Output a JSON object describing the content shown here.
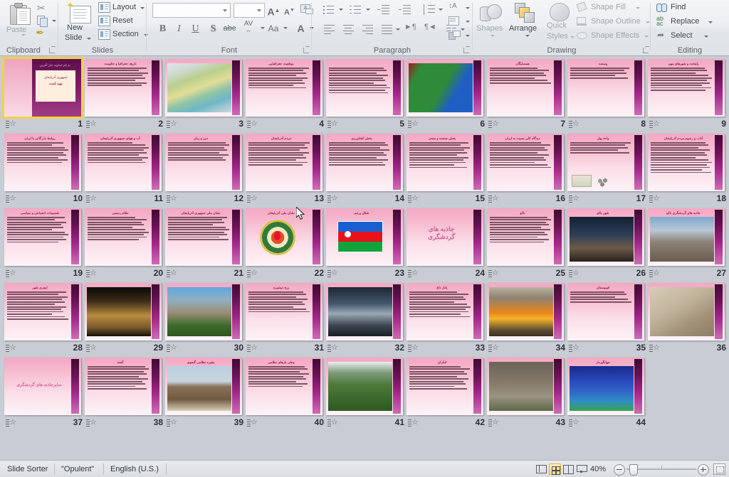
{
  "app": {
    "view_name": "Slide Sorter",
    "theme_name": "\"Opulent\"",
    "language": "English (U.S.)",
    "zoom_level": "40%"
  },
  "ribbon": {
    "groups": [
      {
        "name": "Clipboard",
        "label": "Clipboard"
      },
      {
        "name": "Slides",
        "label": "Slides"
      },
      {
        "name": "Font",
        "label": "Font"
      },
      {
        "name": "Paragraph",
        "label": "Paragraph"
      },
      {
        "name": "Drawing",
        "label": "Drawing"
      },
      {
        "name": "Editing",
        "label": "Editing"
      }
    ],
    "clipboard": {
      "paste_label": "Paste",
      "cut_icon": "scissors-icon",
      "copy_icon": "copy-icon",
      "format_painter_icon": "format-painter-icon"
    },
    "slides": {
      "new_slide_label": "New\nSlide",
      "new_slide_line1": "New",
      "new_slide_line2": "Slide",
      "layout_label": "Layout",
      "reset_label": "Reset",
      "section_label": "Section"
    },
    "font": {
      "font_name_value": "",
      "font_size_value": "",
      "grow_font": "A",
      "shrink_font": "A",
      "clear_formatting": "clear-formatting-icon",
      "bold": "B",
      "italic": "I",
      "underline": "U",
      "shadow": "S",
      "strikethrough": "abc",
      "character_spacing": "AV",
      "change_case": "Aa",
      "font_color": "A"
    },
    "paragraph": {
      "bullets": "bullets-icon",
      "numbering": "numbering-icon",
      "decrease_indent": "decrease-indent-icon",
      "increase_indent": "increase-indent-icon",
      "line_spacing": "line-spacing-icon",
      "align_left": "align-left-icon",
      "center": "center-icon",
      "align_right": "align-right-icon",
      "justify": "justify-icon",
      "ltr": "text-direction-ltr-icon",
      "rtl": "text-direction-rtl-icon",
      "columns": "columns-icon",
      "text_direction": "text-direction-icon",
      "align_text": "align-text-icon",
      "convert_smartart": "convert-to-smartart-icon"
    },
    "drawing": {
      "shapes_label": "Shapes",
      "arrange_label": "Arrange",
      "quick_styles_line1": "Quick",
      "quick_styles_line2": "Styles",
      "shape_fill_label": "Shape Fill",
      "shape_outline_label": "Shape Outline",
      "shape_effects_label": "Shape Effects"
    },
    "editing": {
      "find_label": "Find",
      "replace_label": "Replace",
      "select_label": "Select"
    }
  },
  "status_bar": {
    "view_buttons": [
      {
        "name": "normal-view-button",
        "active": false
      },
      {
        "name": "slide-sorter-view-button",
        "active": true
      },
      {
        "name": "reading-view-button",
        "active": false
      },
      {
        "name": "slide-show-button",
        "active": false
      }
    ],
    "fit_to_window_title": "Fit slide to current window"
  },
  "sorter": {
    "selected_slide": 1,
    "columns": 9,
    "slides": [
      {
        "n": 1,
        "kind": "title",
        "title": "جمهوری آذربایجان",
        "kicker": "به نام خداوند جان آفرین",
        "sub": "جمهوری آذربایجان",
        "sub2": "تهیه کننده",
        "lines": 0
      },
      {
        "n": 2,
        "kind": "text",
        "title": "تاریخ، جغرافیا و حکومت",
        "lines": 8
      },
      {
        "n": 3,
        "kind": "pic",
        "title": "",
        "pic": "relief-map"
      },
      {
        "n": 4,
        "kind": "text",
        "title": "موقعیت جغرافیایی",
        "lines": 9
      },
      {
        "n": 5,
        "kind": "text",
        "title": "",
        "lines": 11
      },
      {
        "n": 6,
        "kind": "pic",
        "title": "",
        "pic": "political-map"
      },
      {
        "n": 7,
        "kind": "text",
        "title": "همسایگان",
        "lines": 7
      },
      {
        "n": 8,
        "kind": "text",
        "title": "وسعت",
        "lines": 5
      },
      {
        "n": 9,
        "kind": "text",
        "title": "پایتخت و شهرهای مهم",
        "lines": 10
      },
      {
        "n": 10,
        "kind": "text",
        "title": "روابط بازرگانی با ایران",
        "lines": 9
      },
      {
        "n": 11,
        "kind": "text",
        "title": "آب و هوای جمهوری آذربایجان",
        "lines": 9
      },
      {
        "n": 12,
        "kind": "text",
        "title": "دین و زبان",
        "lines": 8
      },
      {
        "n": 13,
        "kind": "text",
        "title": "مردم آذربایجان",
        "lines": 10
      },
      {
        "n": 14,
        "kind": "text",
        "title": "بخش کشاورزی",
        "lines": 10
      },
      {
        "n": 15,
        "kind": "text",
        "title": "بخش صنعت و معدن",
        "lines": 11
      },
      {
        "n": 16,
        "kind": "text",
        "title": "دیدگاه کلی نسبت به ایران",
        "lines": 11
      },
      {
        "n": 17,
        "kind": "money",
        "title": "واحد پول",
        "lines": 5
      },
      {
        "n": 18,
        "kind": "text",
        "title": "آداب و رسوم مردم آذربایجان",
        "lines": 13
      },
      {
        "n": 19,
        "kind": "text",
        "title": "تقسیمات اجتماعی و سیاسی",
        "lines": 11
      },
      {
        "n": 20,
        "kind": "text",
        "title": "نظام رسمی",
        "lines": 10
      },
      {
        "n": 21,
        "kind": "text",
        "title": "نشان ملی جمهوری آذربایجان",
        "lines": 10
      },
      {
        "n": 22,
        "kind": "emblem",
        "title": "نشان ملی آذربایجان"
      },
      {
        "n": 23,
        "kind": "flag",
        "title": "شکل پرچم"
      },
      {
        "n": 24,
        "kind": "big",
        "title": "",
        "big": "جاذبه های\nگردشگری"
      },
      {
        "n": 25,
        "kind": "text",
        "title": "باکو",
        "lines": 11
      },
      {
        "n": 26,
        "kind": "pic",
        "title": "شهر باکو",
        "pic": "city-night"
      },
      {
        "n": 27,
        "kind": "pic",
        "title": "جاذبه های گردشگری باکو",
        "pic": "city-panorama"
      },
      {
        "n": 28,
        "kind": "text",
        "title": "ایچری شهر",
        "lines": 12
      },
      {
        "n": 29,
        "kind": "pic",
        "title": "",
        "pic": "fortress-gate"
      },
      {
        "n": 30,
        "kind": "pic",
        "title": "",
        "pic": "maiden-tower"
      },
      {
        "n": 31,
        "kind": "text",
        "title": "برج دوشیزه",
        "lines": 9
      },
      {
        "n": 32,
        "kind": "pic",
        "title": "",
        "pic": "heydar-center"
      },
      {
        "n": 33,
        "kind": "text",
        "title": "یانار داغ",
        "lines": 11
      },
      {
        "n": 34,
        "kind": "pic",
        "title": "",
        "pic": "burning-mountain"
      },
      {
        "n": 35,
        "kind": "text",
        "title": "قوبوستان",
        "lines": 5
      },
      {
        "n": 36,
        "kind": "pic",
        "title": "",
        "pic": "petroglyph"
      },
      {
        "n": 37,
        "kind": "big",
        "title": "",
        "big": "سایرجاذبه های گردشگری",
        "small": true
      },
      {
        "n": 38,
        "kind": "text",
        "title": "گنجه",
        "lines": 10
      },
      {
        "n": 39,
        "kind": "pic",
        "title": "مقبره نظامی گنجوی",
        "pic": "mausoleum"
      },
      {
        "n": 40,
        "kind": "text",
        "title": "وطی بازهای نظامی",
        "lines": 9
      },
      {
        "n": 41,
        "kind": "pic",
        "title": "",
        "pic": "green-valley"
      },
      {
        "n": 42,
        "kind": "text",
        "title": "لنکران",
        "lines": 10
      },
      {
        "n": 43,
        "kind": "pic",
        "title": "",
        "pic": "mountain-road"
      },
      {
        "n": 44,
        "kind": "pic",
        "title": "جهانگیردار",
        "pic": "spongebob"
      }
    ]
  }
}
